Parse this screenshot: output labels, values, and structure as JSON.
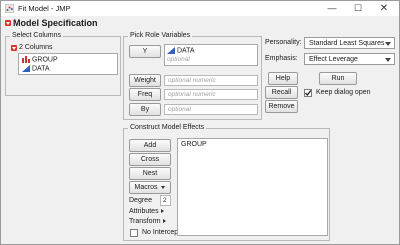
{
  "window": {
    "title": "Fit Model - JMP",
    "controls": {
      "minimize": "—",
      "maximize": "☐",
      "close": "✕"
    }
  },
  "header": {
    "title": "Model Specification"
  },
  "select_columns": {
    "group_label": "Select Columns",
    "count_label": "2 Columns",
    "columns": [
      {
        "name": "GROUP",
        "icon": "nominal-bar-icon"
      },
      {
        "name": "DATA",
        "icon": "continuous-triangle-icon"
      }
    ]
  },
  "pick_roles": {
    "group_label": "Pick Role Variables",
    "y_button": "Y",
    "y_value": "DATA",
    "y_optional": "optional",
    "weight_button": "Weight",
    "weight_placeholder": "optional numeric",
    "freq_button": "Freq",
    "freq_placeholder": "optional numeric",
    "by_button": "By",
    "by_placeholder": "optional"
  },
  "options": {
    "personality_label": "Personality:",
    "personality_value": "Standard Least Squares",
    "emphasis_label": "Emphasis:",
    "emphasis_value": "Effect Leverage",
    "help_button": "Help",
    "run_button": "Run",
    "recall_button": "Recall",
    "keep_open_label": "Keep dialog open",
    "keep_open_checked": true,
    "remove_button": "Remove"
  },
  "construct": {
    "group_label": "Construct Model Effects",
    "add_button": "Add",
    "cross_button": "Cross",
    "nest_button": "Nest",
    "macros_button": "Macros",
    "degree_label": "Degree",
    "degree_value": "2",
    "attributes_label": "Attributes",
    "transform_label": "Transform",
    "no_intercept_label": "No Intercept",
    "no_intercept_checked": false,
    "effects": [
      "GROUP"
    ]
  },
  "colors": {
    "disclosure_red": "#d9342b",
    "nominal_red": "#c0392b",
    "continuous_blue": "#2f5fbf"
  }
}
